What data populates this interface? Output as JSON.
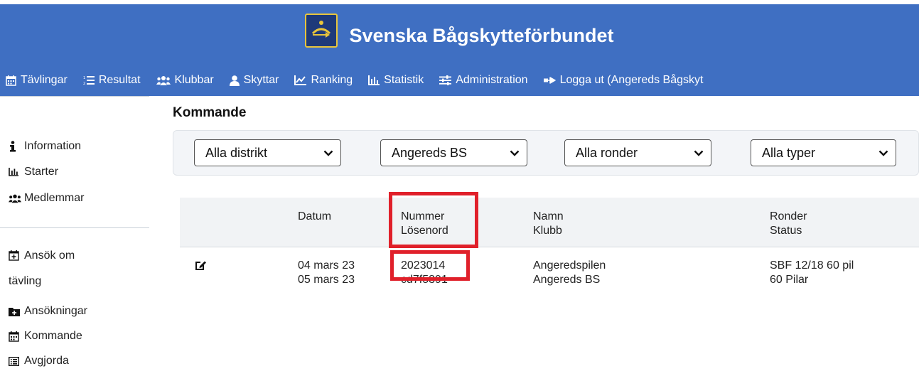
{
  "brand": {
    "title": "Svenska Bågskytteförbundet"
  },
  "topnav": [
    {
      "label": "Tävlingar",
      "icon": "calendar-icon"
    },
    {
      "label": "Resultat",
      "icon": "list-icon"
    },
    {
      "label": "Klubbar",
      "icon": "users-icon"
    },
    {
      "label": "Skyttar",
      "icon": "user-icon"
    },
    {
      "label": "Ranking",
      "icon": "line-chart-icon"
    },
    {
      "label": "Statistik",
      "icon": "bar-chart-icon"
    },
    {
      "label": "Administration",
      "icon": "sliders-icon"
    },
    {
      "label": "Logga ut (Angereds Bågskyt",
      "icon": "sign-out-icon"
    }
  ],
  "sidebar": {
    "group1": [
      {
        "label": "Information",
        "icon": "info-icon"
      },
      {
        "label": "Starter",
        "icon": "bar-chart-icon"
      },
      {
        "label": "Medlemmar",
        "icon": "users-icon"
      }
    ],
    "group2": [
      {
        "label": "Ansök om",
        "label2": "tävling",
        "icon": "calendar-plus-icon"
      },
      {
        "label": "Ansökningar",
        "icon": "folder-plus-icon"
      },
      {
        "label": "Kommande",
        "icon": "calendar-icon"
      },
      {
        "label": "Avgjorda",
        "icon": "list-alt-icon"
      }
    ]
  },
  "main": {
    "title": "Kommande",
    "filters": [
      "Alla distrikt",
      "Angereds BS",
      "Alla ronder",
      "Alla typer"
    ],
    "columns": [
      {
        "line1": "Datum",
        "line2": ""
      },
      {
        "line1": "Nummer",
        "line2": "Lösenord"
      },
      {
        "line1": "Namn",
        "line2": "Klubb"
      },
      {
        "line1": "Ronder",
        "line2": "Status"
      }
    ],
    "rows": [
      {
        "date1": "04 mars 23",
        "date2": "05 mars 23",
        "number": "2023014",
        "password": "cd7f5391",
        "name": "Angeredspilen",
        "club": "Angereds BS",
        "rounds": "SBF 12/18 60 pil",
        "status": "60 Pilar"
      }
    ]
  },
  "colors": {
    "header": "#3f6fc2",
    "highlight": "#e0202a"
  }
}
